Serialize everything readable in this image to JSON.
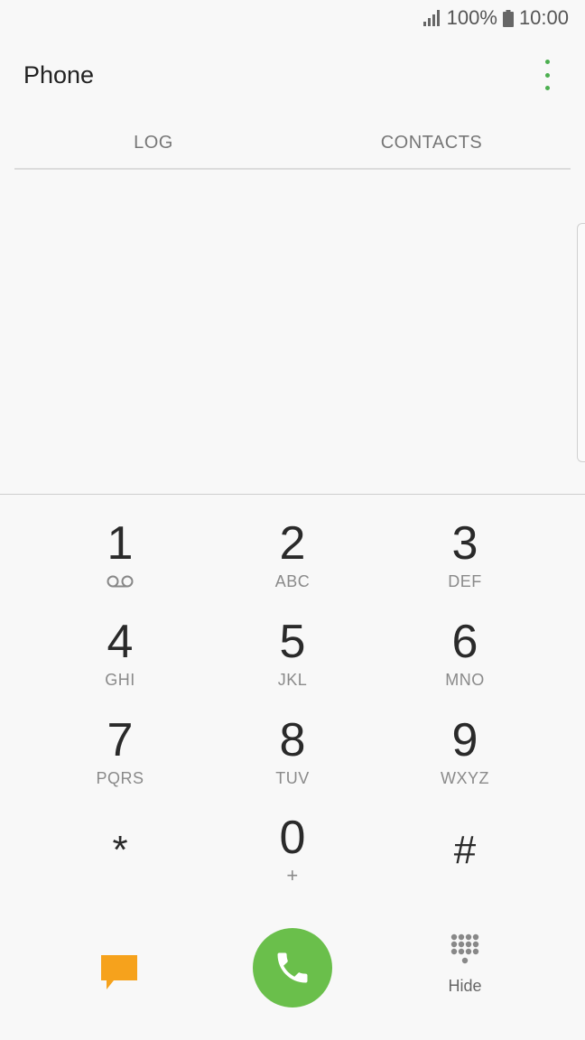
{
  "status_bar": {
    "battery": "100%",
    "time": "10:00"
  },
  "app_bar": {
    "title": "Phone",
    "more_icon": "more-vertical-icon"
  },
  "tabs": [
    {
      "label": "LOG"
    },
    {
      "label": "CONTACTS"
    }
  ],
  "keypad": {
    "keys": [
      {
        "digit": "1",
        "letters": ""
      },
      {
        "digit": "2",
        "letters": "ABC"
      },
      {
        "digit": "3",
        "letters": "DEF"
      },
      {
        "digit": "4",
        "letters": "GHI"
      },
      {
        "digit": "5",
        "letters": "JKL"
      },
      {
        "digit": "6",
        "letters": "MNO"
      },
      {
        "digit": "7",
        "letters": "PQRS"
      },
      {
        "digit": "8",
        "letters": "TUV"
      },
      {
        "digit": "9",
        "letters": "WXYZ"
      },
      {
        "digit": "*",
        "letters": ""
      },
      {
        "digit": "0",
        "letters": "+"
      },
      {
        "digit": "#",
        "letters": ""
      }
    ]
  },
  "bottom_bar": {
    "hide_label": "Hide"
  },
  "colors": {
    "accent_green": "#6abf4b",
    "message_orange": "#f6a21c",
    "menu_green": "#4caf50"
  }
}
